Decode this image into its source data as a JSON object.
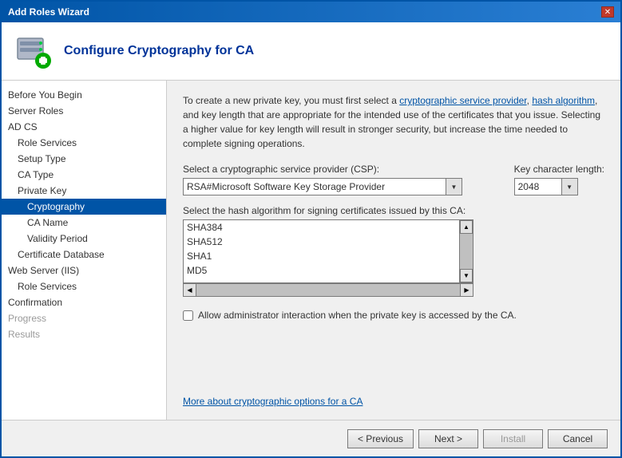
{
  "window": {
    "title": "Add Roles Wizard",
    "close_label": "✕"
  },
  "header": {
    "title": "Configure Cryptography for CA"
  },
  "description": {
    "text_before": "To create a new private key, you must first select a ",
    "link1": "cryptographic service provider",
    "text_mid": ", ",
    "link2": "hash algorithm",
    "text_after": ", and key length that are appropriate for the intended use of the certificates that you issue. Selecting a higher value for key length will result in stronger security, but increase the time needed to complete signing operations."
  },
  "form": {
    "csp_label": "Select a cryptographic service provider (CSP):",
    "csp_value": "RSA#Microsoft Software Key Storage Provider",
    "key_length_label": "Key character length:",
    "key_length_value": "2048",
    "hash_label": "Select the hash algorithm for signing certificates issued by this CA:",
    "hash_items": [
      {
        "label": "SHA384",
        "selected": false
      },
      {
        "label": "SHA512",
        "selected": false
      },
      {
        "label": "SHA1",
        "selected": false
      },
      {
        "label": "MD5",
        "selected": false
      }
    ],
    "checkbox_label": "Allow administrator interaction when the private key is accessed by the CA.",
    "checkbox_checked": false
  },
  "more_link": "More about cryptographic options for a CA",
  "sidebar": {
    "items": [
      {
        "label": "Before You Begin",
        "level": "level1",
        "selected": false,
        "disabled": false
      },
      {
        "label": "Server Roles",
        "level": "level1",
        "selected": false,
        "disabled": false
      },
      {
        "label": "AD CS",
        "level": "level1",
        "selected": false,
        "disabled": false
      },
      {
        "label": "Role Services",
        "level": "level2",
        "selected": false,
        "disabled": false
      },
      {
        "label": "Setup Type",
        "level": "level2",
        "selected": false,
        "disabled": false
      },
      {
        "label": "CA Type",
        "level": "level2",
        "selected": false,
        "disabled": false
      },
      {
        "label": "Private Key",
        "level": "level2",
        "selected": false,
        "disabled": false
      },
      {
        "label": "Cryptography",
        "level": "level3",
        "selected": true,
        "disabled": false
      },
      {
        "label": "CA Name",
        "level": "level3",
        "selected": false,
        "disabled": false
      },
      {
        "label": "Validity Period",
        "level": "level3",
        "selected": false,
        "disabled": false
      },
      {
        "label": "Certificate Database",
        "level": "level2",
        "selected": false,
        "disabled": false
      },
      {
        "label": "Web Server (IIS)",
        "level": "level1",
        "selected": false,
        "disabled": false
      },
      {
        "label": "Role Services",
        "level": "level2",
        "selected": false,
        "disabled": false
      },
      {
        "label": "Confirmation",
        "level": "level1",
        "selected": false,
        "disabled": false
      },
      {
        "label": "Progress",
        "level": "level1",
        "selected": false,
        "disabled": true
      },
      {
        "label": "Results",
        "level": "level1",
        "selected": false,
        "disabled": true
      }
    ]
  },
  "buttons": {
    "previous": "< Previous",
    "next": "Next >",
    "install": "Install",
    "cancel": "Cancel"
  }
}
